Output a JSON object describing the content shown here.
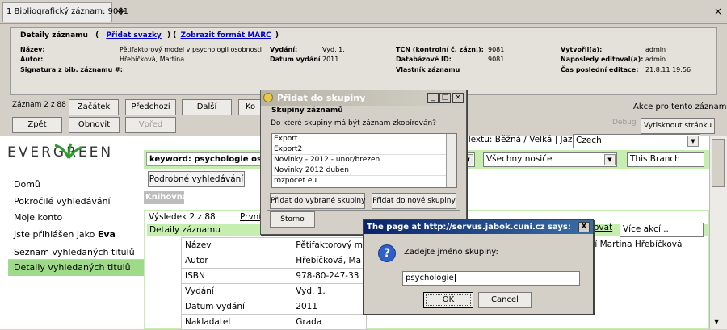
{
  "tab": {
    "title": "1 Bibliografický záznam: 9081",
    "plus": "+",
    "close": "×"
  },
  "summary": {
    "head_label": "Detaily záznamu",
    "open1": "(",
    "add_volumes": "Přidat svazky",
    "mid": ") (",
    "show_marc": "Zobrazit formát MARC",
    "close1": ")",
    "fields": [
      {
        "label": "Název:",
        "value": "Pětifaktorový model v psychologii osobnosti"
      },
      {
        "label": "Autor:",
        "value": "Hřebíčková, Martina"
      },
      {
        "label": "Signatura z bib. záznamu #:",
        "value": ""
      },
      {
        "label": "Vydání:",
        "value": "Vyd. 1."
      },
      {
        "label": "Datum vydání",
        "value": "2011"
      },
      {
        "label": "TCN (kontrolní č. zázn.):",
        "value": "9081"
      },
      {
        "label": "Databázové ID:",
        "value": "9081"
      },
      {
        "label": "Vlastník záznamu",
        "value": ""
      },
      {
        "label": "Vytvořil(a):",
        "value": "admin"
      },
      {
        "label": "Naposledy editoval(a):",
        "value": "admin"
      },
      {
        "label": "Čas poslední editace:",
        "value": "21.8.11 19:56"
      }
    ]
  },
  "toolbar": {
    "record_counter": "Záznam 2 z 88",
    "start": "Začátek",
    "prev": "Předchozí",
    "next": "Další",
    "end": "Ko",
    "back": "Zpět",
    "refresh": "Obnovit",
    "forward": "Vpřed",
    "actions": "Akce pro tento záznam",
    "debug": "Debug",
    "print": "Vytisknout stránku"
  },
  "opac": {
    "logo": "EVERGREEN",
    "nav": [
      "Domů",
      "Pokročilé vyhledávání",
      "Moje konto",
      "Jste přihlášen jako ",
      "Seznam vyhledaných titulů",
      "Detaily vyhledaných titulů"
    ],
    "user": "Eva",
    "keyword_prefix": "keyword:",
    "keyword_query": "psychologie osob",
    "detailed_search": "Podrobné vyhledávání",
    "library_tab": "Knihovna",
    "text_label": "Textu: Běžná / Velká | Jazyk:",
    "language": "Czech",
    "all_media": "Všechny nosiče",
    "branch": "This Branch",
    "result": "Výsledek 2 z 88",
    "first": "První",
    "details_bar": "Detaily záznamu",
    "more_actions": "Více akcí...",
    "ovat": "ovat",
    "author_right": "rí Martina Hřebíčková",
    "table": [
      {
        "label": "Název",
        "value": "Pětifaktorový m"
      },
      {
        "label": "Autor",
        "value": "Hřebíčková, Ma"
      },
      {
        "label": "ISBN",
        "value": "978-80-247-33"
      },
      {
        "label": "Vydání",
        "value": "Vyd. 1."
      },
      {
        "label": "Datum vydání",
        "value": "2011"
      },
      {
        "label": "Nakladatel",
        "value": "Grada"
      }
    ]
  },
  "group_dialog": {
    "title": "Přidat do skupiny",
    "fieldset": "Skupiny záznamů",
    "question": "Do které skupiny má být záznam zkopírován?",
    "items": [
      "Export",
      "Export2",
      "Novinky - 2012 - unor/brezen",
      "Novinky 2012 duben",
      "rozpocet eu"
    ],
    "add_selected": "Přidat do vybrané skupiny",
    "add_new": "Přidat do nové skupiny",
    "cancel": "Storno"
  },
  "prompt": {
    "title": "The page at http://servus.jabok.cuni.cz says:",
    "message": "Zadejte jméno skupiny:",
    "value": "psychologie",
    "ok": "OK",
    "cancel": "Cancel",
    "close": "X"
  }
}
